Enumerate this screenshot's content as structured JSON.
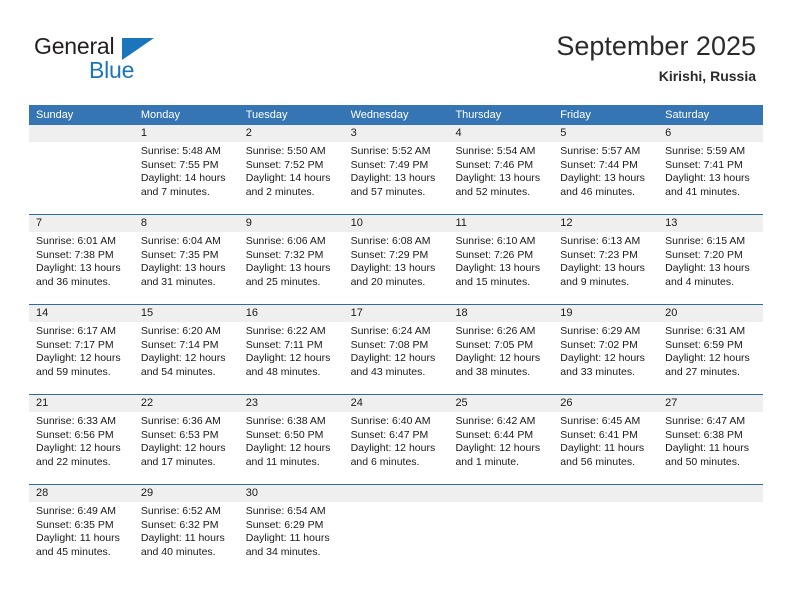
{
  "brand": {
    "line1": "General",
    "line2": "Blue",
    "triangle_color": "#1b75bb"
  },
  "header": {
    "title": "September 2025",
    "location": "Kirishi, Russia"
  },
  "theme": {
    "header_row_bg": "#3575b4",
    "week_separator": "#2b6ca3",
    "date_band_bg": "#efefef",
    "text": "#1a1a1a"
  },
  "calendar": {
    "day_names": [
      "Sunday",
      "Monday",
      "Tuesday",
      "Wednesday",
      "Thursday",
      "Friday",
      "Saturday"
    ],
    "weeks": [
      [
        {
          "date": "",
          "lines": []
        },
        {
          "date": "1",
          "lines": [
            "Sunrise: 5:48 AM",
            "Sunset: 7:55 PM",
            "Daylight: 14 hours",
            "and 7 minutes."
          ]
        },
        {
          "date": "2",
          "lines": [
            "Sunrise: 5:50 AM",
            "Sunset: 7:52 PM",
            "Daylight: 14 hours",
            "and 2 minutes."
          ]
        },
        {
          "date": "3",
          "lines": [
            "Sunrise: 5:52 AM",
            "Sunset: 7:49 PM",
            "Daylight: 13 hours",
            "and 57 minutes."
          ]
        },
        {
          "date": "4",
          "lines": [
            "Sunrise: 5:54 AM",
            "Sunset: 7:46 PM",
            "Daylight: 13 hours",
            "and 52 minutes."
          ]
        },
        {
          "date": "5",
          "lines": [
            "Sunrise: 5:57 AM",
            "Sunset: 7:44 PM",
            "Daylight: 13 hours",
            "and 46 minutes."
          ]
        },
        {
          "date": "6",
          "lines": [
            "Sunrise: 5:59 AM",
            "Sunset: 7:41 PM",
            "Daylight: 13 hours",
            "and 41 minutes."
          ]
        }
      ],
      [
        {
          "date": "7",
          "lines": [
            "Sunrise: 6:01 AM",
            "Sunset: 7:38 PM",
            "Daylight: 13 hours",
            "and 36 minutes."
          ]
        },
        {
          "date": "8",
          "lines": [
            "Sunrise: 6:04 AM",
            "Sunset: 7:35 PM",
            "Daylight: 13 hours",
            "and 31 minutes."
          ]
        },
        {
          "date": "9",
          "lines": [
            "Sunrise: 6:06 AM",
            "Sunset: 7:32 PM",
            "Daylight: 13 hours",
            "and 25 minutes."
          ]
        },
        {
          "date": "10",
          "lines": [
            "Sunrise: 6:08 AM",
            "Sunset: 7:29 PM",
            "Daylight: 13 hours",
            "and 20 minutes."
          ]
        },
        {
          "date": "11",
          "lines": [
            "Sunrise: 6:10 AM",
            "Sunset: 7:26 PM",
            "Daylight: 13 hours",
            "and 15 minutes."
          ]
        },
        {
          "date": "12",
          "lines": [
            "Sunrise: 6:13 AM",
            "Sunset: 7:23 PM",
            "Daylight: 13 hours",
            "and 9 minutes."
          ]
        },
        {
          "date": "13",
          "lines": [
            "Sunrise: 6:15 AM",
            "Sunset: 7:20 PM",
            "Daylight: 13 hours",
            "and 4 minutes."
          ]
        }
      ],
      [
        {
          "date": "14",
          "lines": [
            "Sunrise: 6:17 AM",
            "Sunset: 7:17 PM",
            "Daylight: 12 hours",
            "and 59 minutes."
          ]
        },
        {
          "date": "15",
          "lines": [
            "Sunrise: 6:20 AM",
            "Sunset: 7:14 PM",
            "Daylight: 12 hours",
            "and 54 minutes."
          ]
        },
        {
          "date": "16",
          "lines": [
            "Sunrise: 6:22 AM",
            "Sunset: 7:11 PM",
            "Daylight: 12 hours",
            "and 48 minutes."
          ]
        },
        {
          "date": "17",
          "lines": [
            "Sunrise: 6:24 AM",
            "Sunset: 7:08 PM",
            "Daylight: 12 hours",
            "and 43 minutes."
          ]
        },
        {
          "date": "18",
          "lines": [
            "Sunrise: 6:26 AM",
            "Sunset: 7:05 PM",
            "Daylight: 12 hours",
            "and 38 minutes."
          ]
        },
        {
          "date": "19",
          "lines": [
            "Sunrise: 6:29 AM",
            "Sunset: 7:02 PM",
            "Daylight: 12 hours",
            "and 33 minutes."
          ]
        },
        {
          "date": "20",
          "lines": [
            "Sunrise: 6:31 AM",
            "Sunset: 6:59 PM",
            "Daylight: 12 hours",
            "and 27 minutes."
          ]
        }
      ],
      [
        {
          "date": "21",
          "lines": [
            "Sunrise: 6:33 AM",
            "Sunset: 6:56 PM",
            "Daylight: 12 hours",
            "and 22 minutes."
          ]
        },
        {
          "date": "22",
          "lines": [
            "Sunrise: 6:36 AM",
            "Sunset: 6:53 PM",
            "Daylight: 12 hours",
            "and 17 minutes."
          ]
        },
        {
          "date": "23",
          "lines": [
            "Sunrise: 6:38 AM",
            "Sunset: 6:50 PM",
            "Daylight: 12 hours",
            "and 11 minutes."
          ]
        },
        {
          "date": "24",
          "lines": [
            "Sunrise: 6:40 AM",
            "Sunset: 6:47 PM",
            "Daylight: 12 hours",
            "and 6 minutes."
          ]
        },
        {
          "date": "25",
          "lines": [
            "Sunrise: 6:42 AM",
            "Sunset: 6:44 PM",
            "Daylight: 12 hours",
            "and 1 minute."
          ]
        },
        {
          "date": "26",
          "lines": [
            "Sunrise: 6:45 AM",
            "Sunset: 6:41 PM",
            "Daylight: 11 hours",
            "and 56 minutes."
          ]
        },
        {
          "date": "27",
          "lines": [
            "Sunrise: 6:47 AM",
            "Sunset: 6:38 PM",
            "Daylight: 11 hours",
            "and 50 minutes."
          ]
        }
      ],
      [
        {
          "date": "28",
          "lines": [
            "Sunrise: 6:49 AM",
            "Sunset: 6:35 PM",
            "Daylight: 11 hours",
            "and 45 minutes."
          ]
        },
        {
          "date": "29",
          "lines": [
            "Sunrise: 6:52 AM",
            "Sunset: 6:32 PM",
            "Daylight: 11 hours",
            "and 40 minutes."
          ]
        },
        {
          "date": "30",
          "lines": [
            "Sunrise: 6:54 AM",
            "Sunset: 6:29 PM",
            "Daylight: 11 hours",
            "and 34 minutes."
          ]
        },
        {
          "date": "",
          "lines": []
        },
        {
          "date": "",
          "lines": []
        },
        {
          "date": "",
          "lines": []
        },
        {
          "date": "",
          "lines": []
        }
      ]
    ]
  }
}
